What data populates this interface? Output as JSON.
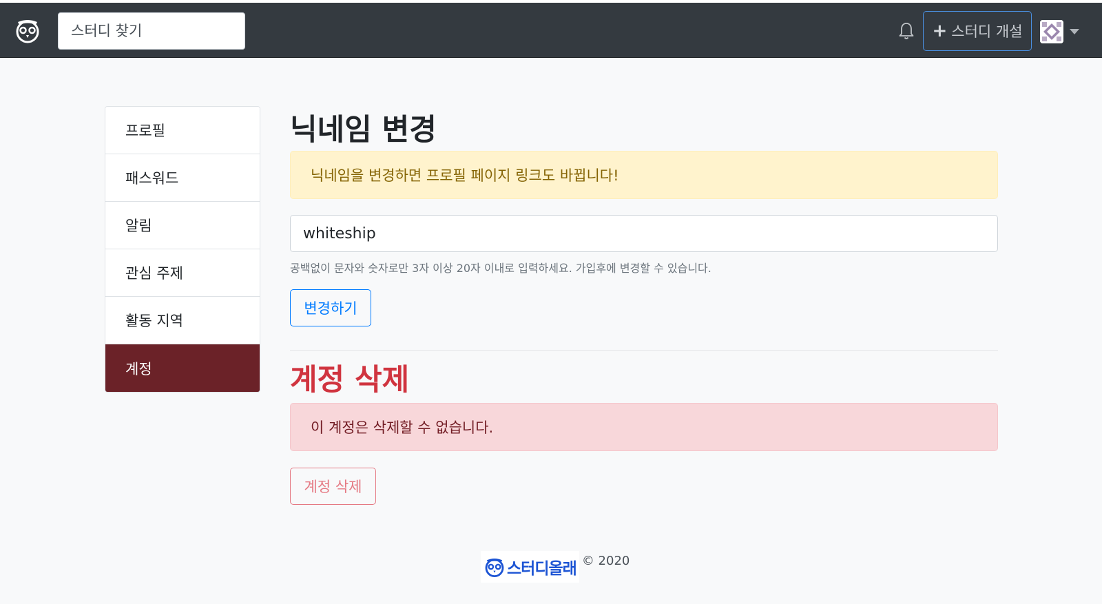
{
  "navbar": {
    "search_placeholder": "스터디 찾기",
    "create_study_label": "스터디 개설"
  },
  "sidebar": {
    "items": [
      {
        "label": "프로필",
        "active": false
      },
      {
        "label": "패스워드",
        "active": false
      },
      {
        "label": "알림",
        "active": false
      },
      {
        "label": "관심 주제",
        "active": false
      },
      {
        "label": "활동 지역",
        "active": false
      },
      {
        "label": "계정",
        "active": true
      }
    ]
  },
  "nickname": {
    "title": "닉네임 변경",
    "warning": "닉네임을 변경하면 프로필 페이지 링크도 바뀝니다!",
    "value": "whiteship",
    "help": "공백없이 문자와 숫자로만 3자 이상 20자 이내로 입력하세요. 가입후에 변경할 수 있습니다.",
    "submit_label": "변경하기"
  },
  "delete": {
    "title": "계정 삭제",
    "message": "이 계정은 삭제할 수 없습니다.",
    "button_label": "계정 삭제"
  },
  "footer": {
    "brand": "스터디올래",
    "copyright": "© 2020"
  },
  "colors": {
    "navbar_bg": "#343a40",
    "sidebar_active": "#6b2228",
    "danger": "#dc3545",
    "primary": "#007bff",
    "brand_blue": "#1c54d4"
  }
}
